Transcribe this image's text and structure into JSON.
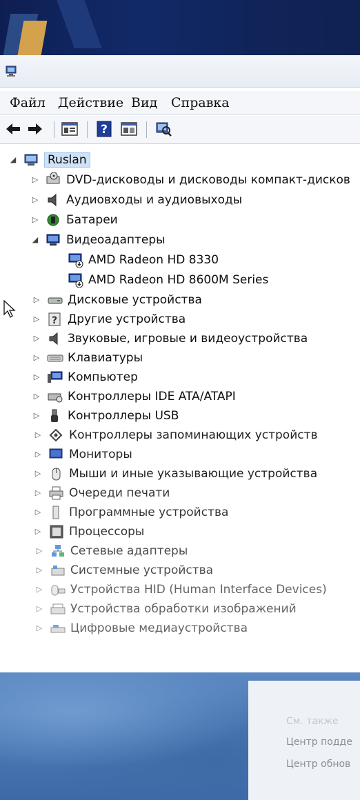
{
  "menu": {
    "file": "Файл",
    "action": "Действие",
    "view": "Вид",
    "help": "Справка"
  },
  "toolbar": {
    "buttons": [
      "back-icon",
      "forward-icon",
      "properties-icon",
      "help-icon",
      "console-tree-icon",
      "scan-hardware-icon"
    ]
  },
  "tree": {
    "root": "Ruslan",
    "categories": {
      "dvd": "DVD-дисководы и дисководы компакт-дисков",
      "audio_io": "Аудиовходы и аудиовыходы",
      "batteries": "Батареи",
      "video": "Видеоадаптеры",
      "video_child_1": "AMD Radeon HD 8330",
      "video_child_2": "AMD Radeon HD 8600M Series",
      "disks": "Дисковые устройства",
      "other": "Другие устройства",
      "sound": "Звуковые, игровые и видеоустройства",
      "keyboards": "Клавиатуры",
      "computer": "Компьютер",
      "ide": "Контроллеры IDE ATA/ATAPI",
      "usb": "Контроллеры USB",
      "storage": "Контроллеры запоминающих устройств",
      "monitors": "Мониторы",
      "mice": "Мыши и иные указывающие устройства",
      "print_queues": "Очереди печати",
      "software": "Программные устройства",
      "processors": "Процессоры",
      "network": "Сетевые адаптеры",
      "system": "Системные устройства",
      "hid": "Устройства HID (Human Interface Devices)",
      "imaging": "Устройства обработки изображений",
      "media": "Цифровые медиаустройства"
    }
  },
  "side_panel": {
    "line1": "См. также",
    "line2": "Центр подде",
    "line3": "Центр обнов"
  }
}
